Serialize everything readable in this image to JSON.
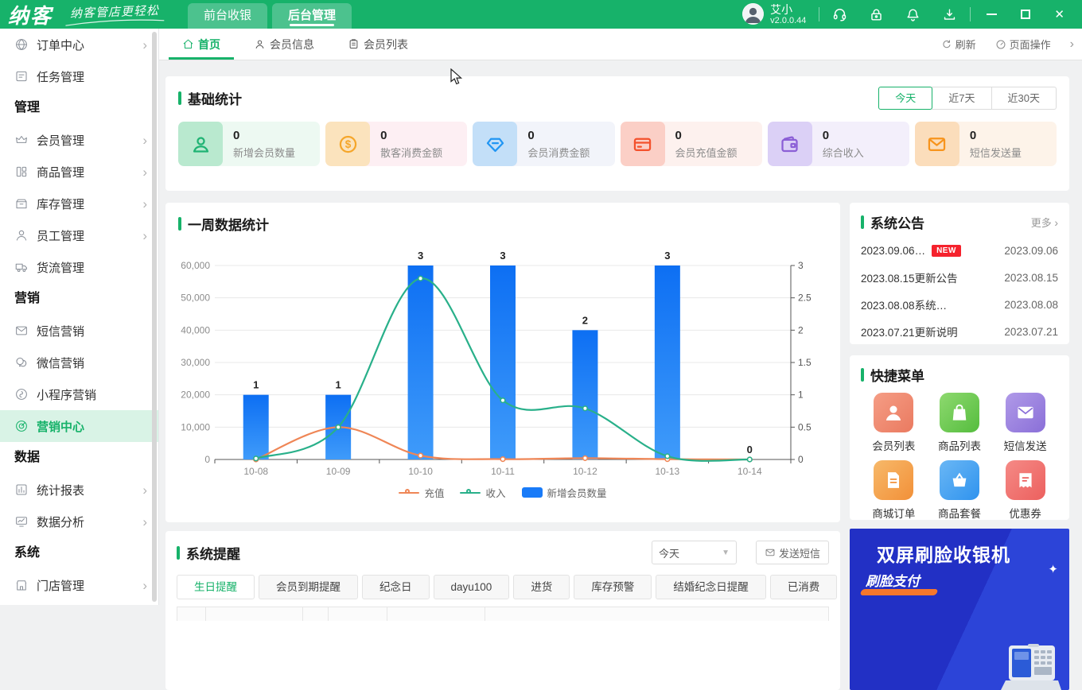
{
  "header": {
    "logo": "纳客",
    "slogan": "纳客管店更轻松",
    "nav_tabs": [
      {
        "label": "前台收银",
        "active": false
      },
      {
        "label": "后台管理",
        "active": true
      }
    ],
    "user": {
      "name": "艾小",
      "version": "v2.0.0.44"
    },
    "tool_icons": [
      "service-icon",
      "lock-icon",
      "bell-icon",
      "download-icon"
    ]
  },
  "sidebar": {
    "items": [
      {
        "type": "item",
        "label": "订单中心",
        "icon": "globe-icon",
        "chevron": true
      },
      {
        "type": "item",
        "label": "任务管理",
        "icon": "task-icon",
        "chevron": false
      },
      {
        "type": "section",
        "label": "管理"
      },
      {
        "type": "item",
        "label": "会员管理",
        "icon": "crown-icon",
        "chevron": true
      },
      {
        "type": "item",
        "label": "商品管理",
        "icon": "goods-icon",
        "chevron": true
      },
      {
        "type": "item",
        "label": "库存管理",
        "icon": "stock-icon",
        "chevron": true
      },
      {
        "type": "item",
        "label": "员工管理",
        "icon": "staff-icon",
        "chevron": true
      },
      {
        "type": "item",
        "label": "货流管理",
        "icon": "truck-icon",
        "chevron": false
      },
      {
        "type": "section",
        "label": "营销"
      },
      {
        "type": "item",
        "label": "短信营销",
        "icon": "sms-icon",
        "chevron": false
      },
      {
        "type": "item",
        "label": "微信营销",
        "icon": "wechat-icon",
        "chevron": false
      },
      {
        "type": "item",
        "label": "小程序营销",
        "icon": "miniapp-icon",
        "chevron": false
      },
      {
        "type": "item",
        "label": "营销中心",
        "icon": "target-icon",
        "chevron": false,
        "active": true
      },
      {
        "type": "section",
        "label": "数据"
      },
      {
        "type": "item",
        "label": "统计报表",
        "icon": "report-icon",
        "chevron": true
      },
      {
        "type": "item",
        "label": "数据分析",
        "icon": "analysis-icon",
        "chevron": true
      },
      {
        "type": "section",
        "label": "系统"
      },
      {
        "type": "item",
        "label": "门店管理",
        "icon": "store-icon",
        "chevron": true
      }
    ]
  },
  "tabbar": {
    "tabs": [
      {
        "label": "首页",
        "icon": "home-icon",
        "active": true
      },
      {
        "label": "会员信息",
        "icon": "person-icon",
        "active": false
      },
      {
        "label": "会员列表",
        "icon": "clipboard-icon",
        "active": false
      }
    ],
    "actions": [
      {
        "label": "刷新",
        "icon": "refresh-icon"
      },
      {
        "label": "页面操作",
        "icon": "gauge-icon"
      }
    ]
  },
  "base_stats": {
    "title": "基础统计",
    "filters": [
      {
        "label": "今天",
        "active": true
      },
      {
        "label": "近7天",
        "active": false
      },
      {
        "label": "近30天",
        "active": false
      }
    ],
    "cards": [
      {
        "icon": "member-icon",
        "value": "0",
        "label": "新增会员数量",
        "accent": "#1fb373",
        "icon_bg": "#b9e9cf",
        "card_bg": "#edf9f2"
      },
      {
        "icon": "coin-icon",
        "value": "0",
        "label": "散客消费金额",
        "accent": "#f5a62a",
        "icon_bg": "#fbe3bd",
        "card_bg": "#fdeff3"
      },
      {
        "icon": "diamond-icon",
        "value": "0",
        "label": "会员消费金额",
        "accent": "#2196f3",
        "icon_bg": "#c3dff8",
        "card_bg": "#f2f4fa"
      },
      {
        "icon": "credit-card-icon",
        "value": "0",
        "label": "会员充值金额",
        "accent": "#f4512c",
        "icon_bg": "#fbcfc6",
        "card_bg": "#fdf1ee"
      },
      {
        "icon": "wallet-icon",
        "value": "0",
        "label": "综合收入",
        "accent": "#8b5fd6",
        "icon_bg": "#dbd0f6",
        "card_bg": "#f3effb"
      },
      {
        "icon": "mail-icon",
        "value": "0",
        "label": "短信发送量",
        "accent": "#f7941d",
        "icon_bg": "#fbddbb",
        "card_bg": "#fdf3e9"
      }
    ]
  },
  "week_chart": {
    "title": "一周数据统计",
    "chart_data": {
      "type": "bar+line",
      "categories": [
        "10-08",
        "10-09",
        "10-10",
        "10-11",
        "10-12",
        "10-13",
        "10-14"
      ],
      "series": [
        {
          "name": "充值",
          "type": "line",
          "axis": "left",
          "color": "#ef8656",
          "values": [
            0,
            10000,
            1200,
            100,
            400,
            100,
            0
          ]
        },
        {
          "name": "收入",
          "type": "line",
          "axis": "left",
          "color": "#29b08a",
          "values": [
            300,
            10000,
            56000,
            18300,
            15800,
            1000,
            0
          ]
        },
        {
          "name": "新增会员数量",
          "type": "bar",
          "axis": "right",
          "color": "#197bf8",
          "values": [
            1,
            1,
            3,
            3,
            2,
            3,
            0
          ]
        }
      ],
      "left_axis": {
        "min": 0,
        "max": 60000,
        "step": 10000
      },
      "right_axis": {
        "min": 0,
        "max": 3,
        "step": 0.5
      },
      "legend_position": "bottom",
      "grid": true
    }
  },
  "announcements": {
    "title": "系统公告",
    "more": "更多",
    "rows": [
      {
        "text": "2023.09.06…",
        "badge": "NEW",
        "date": "2023.09.06"
      },
      {
        "text": "2023.08.15更新公告",
        "badge": "",
        "date": "2023.08.15"
      },
      {
        "text": "2023.08.08系统…",
        "badge": "",
        "date": "2023.08.08"
      },
      {
        "text": "2023.07.21更新说明",
        "badge": "",
        "date": "2023.07.21"
      }
    ]
  },
  "quick_menu": {
    "title": "快捷菜单",
    "items": [
      {
        "label": "会员列表",
        "icon": "person-icon",
        "c1": "#f59d85",
        "c2": "#ea7a60"
      },
      {
        "label": "商品列表",
        "icon": "bag-icon",
        "c1": "#8ed96f",
        "c2": "#55bd3e"
      },
      {
        "label": "短信发送",
        "icon": "mail-icon",
        "c1": "#b09ae8",
        "c2": "#8a6fd8"
      },
      {
        "label": "商城订单",
        "icon": "doc-icon",
        "c1": "#f7b96a",
        "c2": "#f29038"
      },
      {
        "label": "商品套餐",
        "icon": "basket-icon",
        "c1": "#6ab7f5",
        "c2": "#2f93ee"
      },
      {
        "label": "优惠券",
        "icon": "coupon-icon",
        "c1": "#f58a86",
        "c2": "#ec605e"
      }
    ]
  },
  "reminders": {
    "title": "系统提醒",
    "filter_value": "今天",
    "send_sms": "发送短信",
    "tabs": [
      {
        "label": "生日提醒",
        "active": true
      },
      {
        "label": "会员到期提醒",
        "active": false
      },
      {
        "label": "纪念日",
        "active": false
      },
      {
        "label": "dayu100",
        "active": false
      },
      {
        "label": "进货",
        "active": false
      },
      {
        "label": "库存预警",
        "active": false
      },
      {
        "label": "结婚纪念日提醒",
        "active": false
      },
      {
        "label": "已消费",
        "active": false
      }
    ]
  },
  "banner": {
    "line1": "双屏刷脸收银机",
    "line2": "刷脸支付"
  }
}
